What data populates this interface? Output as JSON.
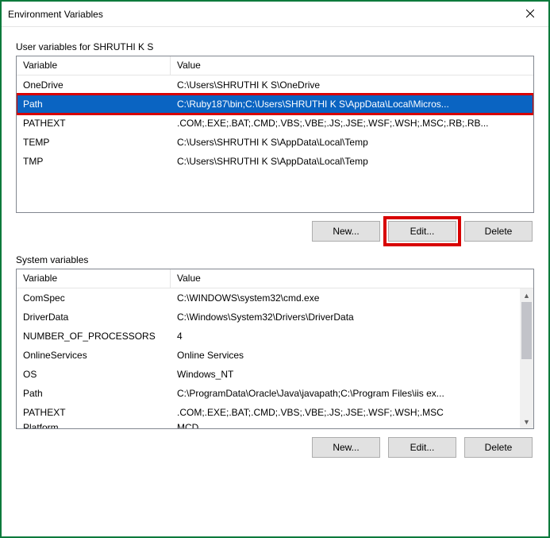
{
  "titlebar": {
    "title": "Environment Variables"
  },
  "user_section": {
    "label": "User variables for SHRUTHI K S",
    "columns": {
      "variable": "Variable",
      "value": "Value"
    },
    "rows": [
      {
        "variable": "OneDrive",
        "value": "C:\\Users\\SHRUTHI K S\\OneDrive",
        "selected": false
      },
      {
        "variable": "Path",
        "value": "C:\\Ruby187\\bin;C:\\Users\\SHRUTHI K S\\AppData\\Local\\Micros...",
        "selected": true
      },
      {
        "variable": "PATHEXT",
        "value": ".COM;.EXE;.BAT;.CMD;.VBS;.VBE;.JS;.JSE;.WSF;.WSH;.MSC;.RB;.RB...",
        "selected": false
      },
      {
        "variable": "TEMP",
        "value": "C:\\Users\\SHRUTHI K S\\AppData\\Local\\Temp",
        "selected": false
      },
      {
        "variable": "TMP",
        "value": "C:\\Users\\SHRUTHI K S\\AppData\\Local\\Temp",
        "selected": false
      }
    ],
    "buttons": {
      "new": "New...",
      "edit": "Edit...",
      "delete": "Delete"
    }
  },
  "system_section": {
    "label": "System variables",
    "columns": {
      "variable": "Variable",
      "value": "Value"
    },
    "rows": [
      {
        "variable": "ComSpec",
        "value": "C:\\WINDOWS\\system32\\cmd.exe"
      },
      {
        "variable": "DriverData",
        "value": "C:\\Windows\\System32\\Drivers\\DriverData"
      },
      {
        "variable": "NUMBER_OF_PROCESSORS",
        "value": "4"
      },
      {
        "variable": "OnlineServices",
        "value": "Online Services"
      },
      {
        "variable": "OS",
        "value": "Windows_NT"
      },
      {
        "variable": "Path",
        "value": "C:\\ProgramData\\Oracle\\Java\\javapath;C:\\Program Files\\iis ex..."
      },
      {
        "variable": "PATHEXT",
        "value": ".COM;.EXE;.BAT;.CMD;.VBS;.VBE;.JS;.JSE;.WSF;.WSH;.MSC"
      }
    ],
    "partial_row": {
      "variable": "Platform",
      "value": "MCD"
    },
    "buttons": {
      "new": "New...",
      "edit": "Edit...",
      "delete": "Delete"
    }
  }
}
